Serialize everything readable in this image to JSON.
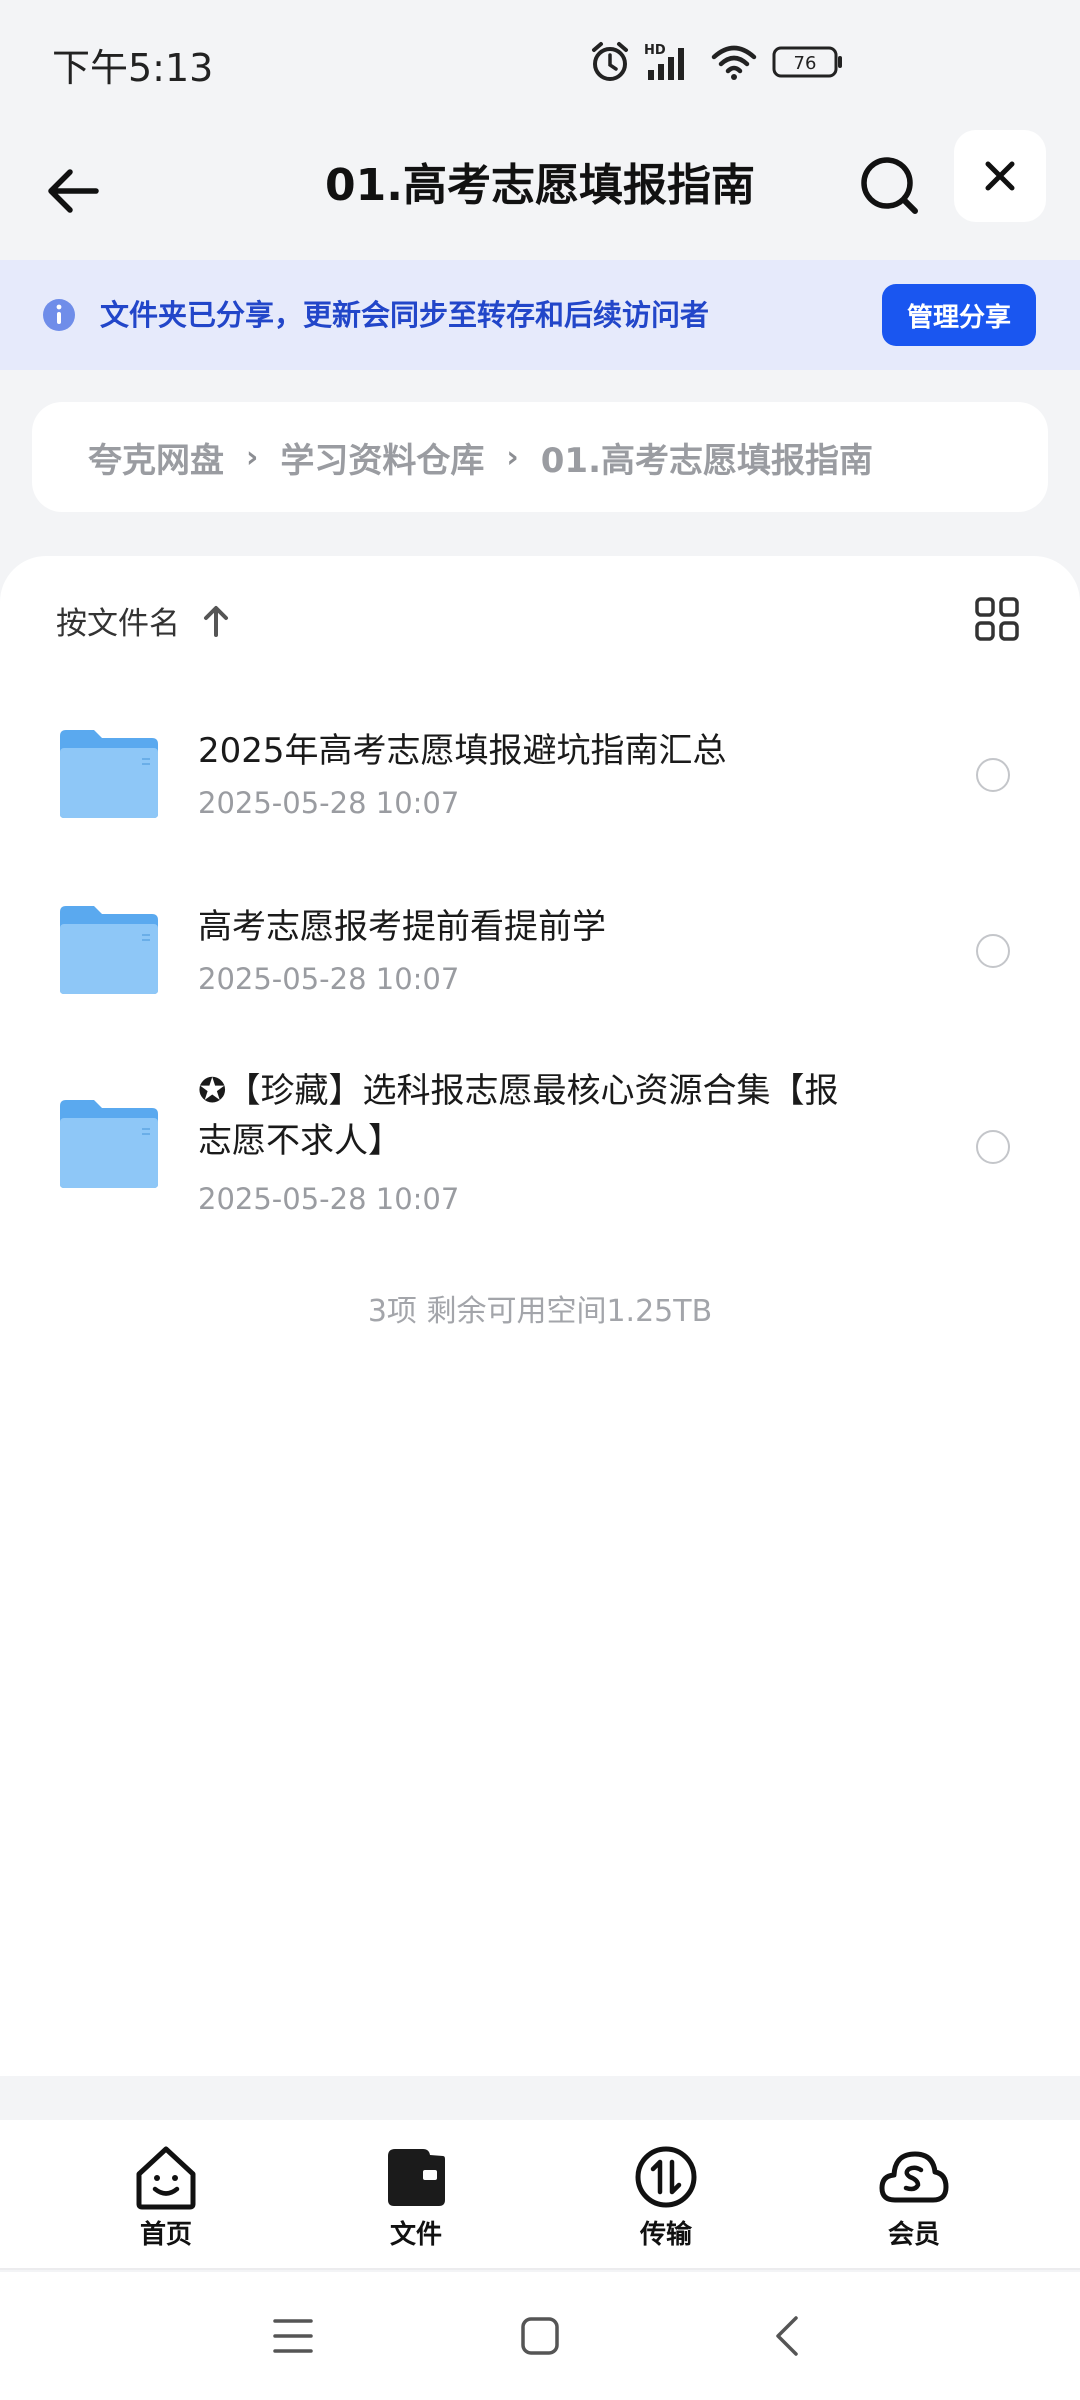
{
  "status_bar": {
    "time": "下午5:13",
    "network_label": "HD",
    "battery": "76"
  },
  "nav": {
    "title": "01.高考志愿填报指南"
  },
  "share_banner": {
    "text": "文件夹已分享，更新会同步至转存和后续访问者",
    "manage_label": "管理分享"
  },
  "breadcrumb": {
    "items": [
      "夸克网盘",
      "学习资料仓库",
      "01.高考志愿填报指南"
    ]
  },
  "sort": {
    "label": "按文件名"
  },
  "files": [
    {
      "name": "2025年高考志愿填报避坑指南汇总",
      "date": "2025-05-28 10:07"
    },
    {
      "name": "高考志愿报考提前看提前学",
      "date": "2025-05-28 10:07"
    },
    {
      "name": "✪【珍藏】选科报志愿最核心资源合集【报",
      "name_line2": "志愿不求人】",
      "date": "2025-05-28 10:07"
    }
  ],
  "summary": "3项  剩余可用空间1.25TB",
  "tabs": [
    {
      "label": "首页",
      "icon": "home-smile-icon"
    },
    {
      "label": "文件",
      "icon": "wallet-folder-icon"
    },
    {
      "label": "传输",
      "icon": "transfer-icon"
    },
    {
      "label": "会员",
      "icon": "cloud-member-icon"
    }
  ],
  "colors": {
    "accent": "#1a56f0",
    "banner_bg": "#e6eafb",
    "banner_text": "#2246c9",
    "folder": "#6ab4f5"
  }
}
